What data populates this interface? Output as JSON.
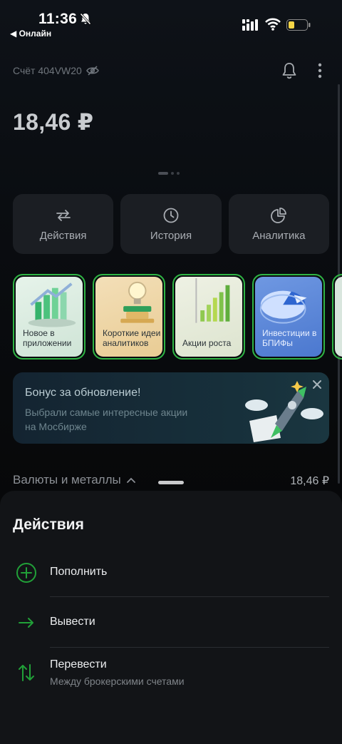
{
  "status_bar": {
    "time": "11:36",
    "back_app": "◀ Онлайн"
  },
  "header": {
    "account": "Счёт 404VW20"
  },
  "balance": "18,46 ₽",
  "actions": [
    {
      "label": "Действия",
      "icon": "transfer-arrows-icon"
    },
    {
      "label": "История",
      "icon": "clock-icon"
    },
    {
      "label": "Аналитика",
      "icon": "pie-chart-icon"
    }
  ],
  "stories": [
    {
      "label": "Новое в приложении",
      "bg": "#d7eadf"
    },
    {
      "label": "Короткие идеи аналитиков",
      "bg": "#f0d9b0"
    },
    {
      "label": "Акции роста",
      "bg": "#e8eddc"
    },
    {
      "label": "Инвестиции в БПИФы",
      "bg": "#5a86d8"
    }
  ],
  "promo": {
    "title": "Бонус за обновление!",
    "subtitle": "Выбрали самые интересные акции на Мосбирже"
  },
  "currency_section": {
    "label": "Валюты и металлы",
    "value": "18,46 ₽"
  },
  "sheet": {
    "title": "Действия",
    "items": [
      {
        "title": "Пополнить",
        "icon": "plus-circle-icon"
      },
      {
        "title": "Вывести",
        "icon": "arrow-right-icon"
      },
      {
        "title": "Перевести",
        "subtitle": "Между брокерскими счетами",
        "icon": "swap-vertical-icon"
      }
    ]
  },
  "colors": {
    "accent_green": "#21a038",
    "story_border": "#2fb544",
    "sheet_bg": "#121417"
  }
}
